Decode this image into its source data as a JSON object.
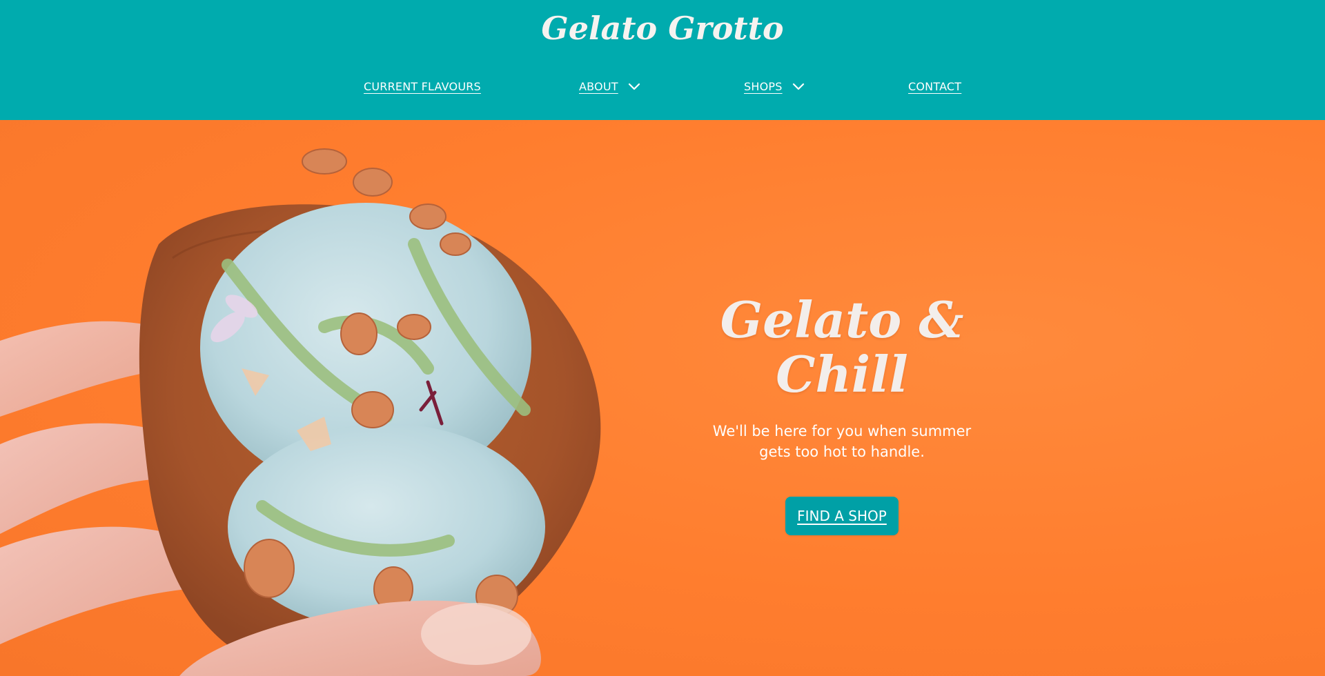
{
  "brand": {
    "name": "Gelato Grotto"
  },
  "nav": {
    "items": [
      {
        "label": "CURRENT FLAVOURS",
        "has_dropdown": false
      },
      {
        "label": "ABOUT",
        "has_dropdown": true
      },
      {
        "label": "SHOPS",
        "has_dropdown": true
      },
      {
        "label": "CONTACT",
        "has_dropdown": false
      }
    ]
  },
  "hero": {
    "title": "Gelato & Chill",
    "subtitle": "We'll be here for you when summer gets too hot to handle.",
    "cta_label": "FIND A SHOP",
    "image": "hand-holding-gelato-waffle-cone"
  },
  "colors": {
    "header": "#00abae",
    "hero_background": "#ff7f32",
    "cta": "#00a0a6",
    "text_light": "#ffffff"
  }
}
